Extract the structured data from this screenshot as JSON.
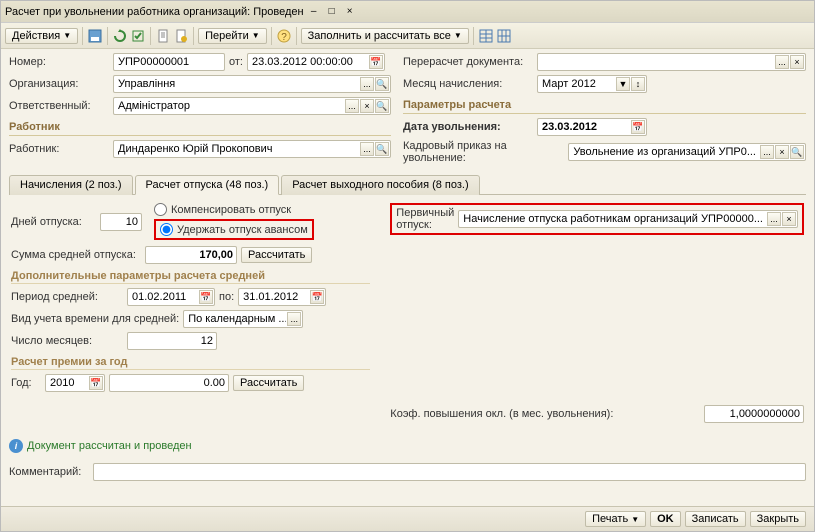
{
  "title": "Расчет при увольнении работника организаций: Проведен",
  "toolbar": {
    "actions": "Действия",
    "go": "Перейти",
    "fillcalc": "Заполнить и рассчитать все"
  },
  "top": {
    "number_label": "Номер:",
    "number_value": "УПР00000001",
    "from_label": "от:",
    "from_value": "23.03.2012 00:00:00",
    "org_label": "Организация:",
    "org_value": "Управління",
    "resp_label": "Ответственный:",
    "resp_value": "Адміністратор",
    "recalc_label": "Перерасчет документа:",
    "month_label": "Месяц начисления:",
    "month_value": "Март 2012"
  },
  "params": {
    "section": "Параметры расчета",
    "dismiss_date_label": "Дата увольнения:",
    "dismiss_date_value": "23.03.2012",
    "order_label": "Кадровый приказ на увольнение:",
    "order_value": "Увольнение из организаций УПР0..."
  },
  "worker": {
    "section": "Работник",
    "label": "Работник:",
    "value": "Диндаренко Юрій Прокопович"
  },
  "tabs": {
    "t1": "Начисления (2 поз.)",
    "t2": "Расчет отпуска (48 поз.)",
    "t3": "Расчет выходного пособия (8 поз.)"
  },
  "vac": {
    "days_label": "Дней отпуска:",
    "days_value": "10",
    "opt_compensate": "Компенсировать отпуск",
    "opt_advance": "Удержать отпуск авансом",
    "avgsum_label": "Сумма средней отпуска:",
    "avgsum_value": "170,00",
    "calc_btn": "Рассчитать",
    "primary_label": "Первичный отпуск:",
    "primary_value": "Начисление отпуска работникам организаций УПР00000..."
  },
  "addparams": {
    "section": "Дополнительные параметры расчета средней",
    "period_label": "Период средней:",
    "period_from": "01.02.2011",
    "period_to_label": "по:",
    "period_to": "31.01.2012",
    "time_label": "Вид учета времени для средней:",
    "time_value": "По календарным ...",
    "months_label": "Число месяцев:",
    "months_value": "12"
  },
  "bonus": {
    "section": "Расчет премии за год",
    "year_label": "Год:",
    "year_value": "2010",
    "sum_value": "0.00",
    "calc_btn": "Рассчитать"
  },
  "coef": {
    "label": "Коэф. повышения окл. (в мес. увольнения):",
    "value": "1,0000000000"
  },
  "info": "Документ рассчитан и проведен",
  "comment_label": "Комментарий:",
  "footer": {
    "print": "Печать",
    "ok": "OK",
    "write": "Записать",
    "close": "Закрыть"
  }
}
